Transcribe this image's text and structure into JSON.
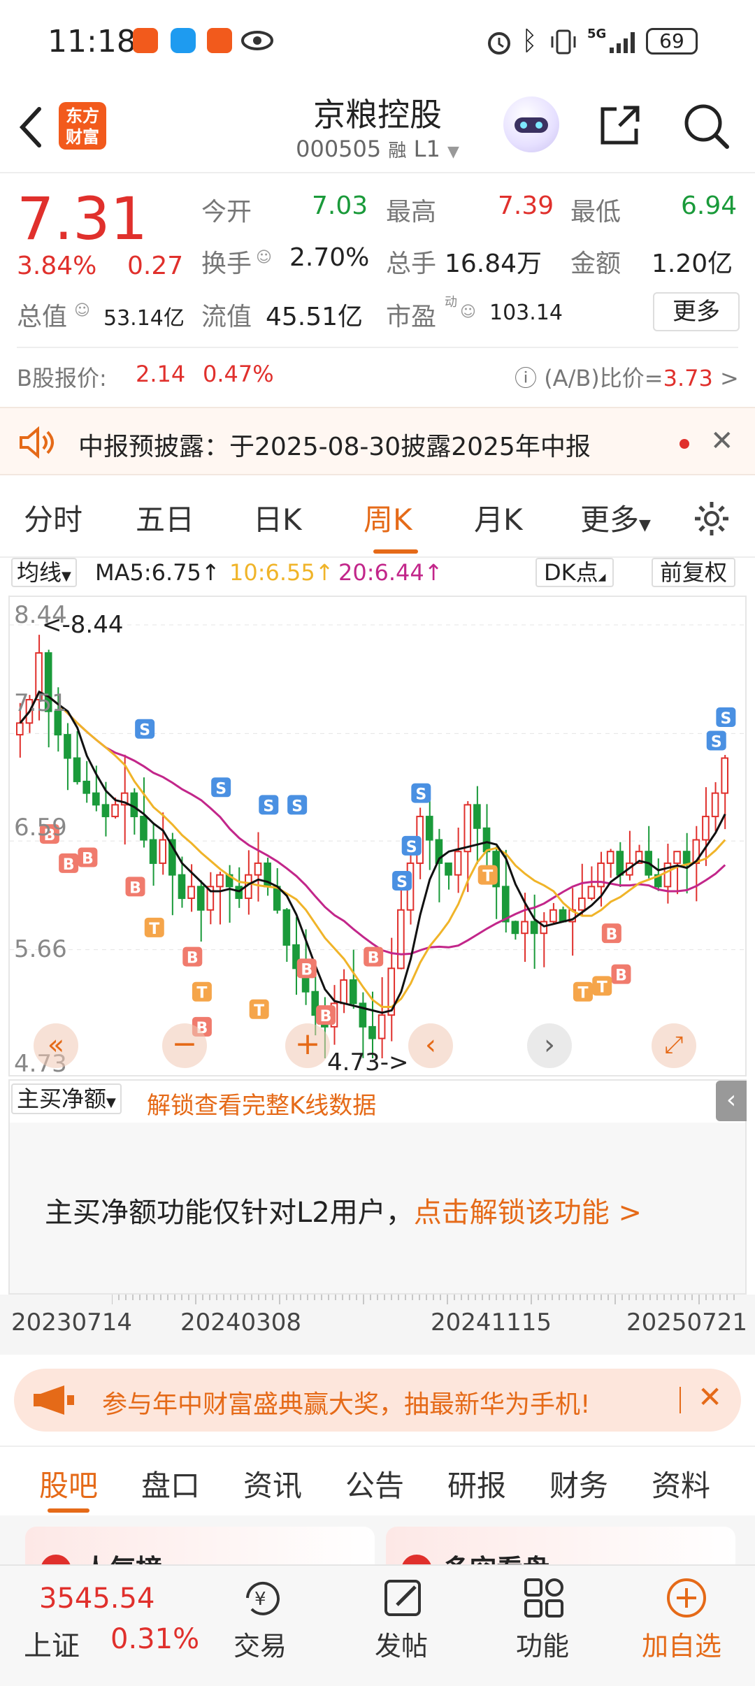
{
  "status": {
    "time": "11:18",
    "battery": "69",
    "network": "5G"
  },
  "header": {
    "logo_line1": "东方",
    "logo_line2": "财富",
    "title": "京粮控股",
    "code": "000505",
    "tag": "融",
    "level": "L1"
  },
  "quote": {
    "price": "7.31",
    "change_pct": "3.84%",
    "change": "0.27",
    "open_label": "今开",
    "open": "7.03",
    "high_label": "最高",
    "high": "7.39",
    "low_label": "最低",
    "low": "6.94",
    "turnover_label": "换手",
    "turnover": "2.70%",
    "volume_label": "总手",
    "volume": "16.84万",
    "amount_label": "金额",
    "amount": "1.20亿",
    "mktcap_label": "总值",
    "mktcap": "53.14亿",
    "float_label": "流值",
    "float": "45.51亿",
    "pe_label": "市盈",
    "pe_sup": "动",
    "pe": "103.14",
    "more_label": "更多"
  },
  "bshare": {
    "label": "B股报价:",
    "price": "2.14",
    "pct": "0.47%",
    "ratio_label": "(A/B)比价=",
    "ratio": "3.73",
    "arrow": ">"
  },
  "notice": {
    "text": "中报预披露：于2025-08-30披露2025年中报"
  },
  "tabs": {
    "items": [
      "分时",
      "五日",
      "日K",
      "周K",
      "月K",
      "更多"
    ],
    "active": "周K"
  },
  "chart_toolbar": {
    "ma_select": "均线",
    "ma5": "MA5:6.75↑",
    "ma10": "10:6.55↑",
    "ma20": "20:6.44↑",
    "dk": "DK点",
    "adjust": "前复权"
  },
  "chart_data": {
    "type": "candlestick",
    "y_ticks": [
      "8.44",
      "7.51",
      "6.59",
      "5.66",
      "4.73"
    ],
    "ylim": [
      4.73,
      8.44
    ],
    "max_label": "<-8.44",
    "min_label": "4.73->",
    "x_ticks": [
      "20230714",
      "20240308",
      "20241115",
      "20250721"
    ],
    "colors": {
      "up": "#e0302c",
      "down": "#1a9a3a",
      "ma5": "#111111",
      "ma10": "#f0b429",
      "ma20": "#c2268a"
    }
  },
  "subchart": {
    "select": "主买净额",
    "unlock": "解锁查看完整K线数据",
    "msg": "主买净额功能仅针对L2用户，",
    "link": "点击解锁该功能 >"
  },
  "banner": {
    "text": "参与年中财富盛典赢大奖，抽最新华为手机!"
  },
  "section_tabs": {
    "items": [
      "股吧",
      "盘口",
      "资讯",
      "公告",
      "研报",
      "财务",
      "资料"
    ],
    "active": "股吧"
  },
  "peek": {
    "left": "人气榜",
    "right": "多空看盘"
  },
  "bottom": {
    "index_value": "3545.54",
    "index_name": "上证",
    "index_pct": "0.31%",
    "trade": "交易",
    "post": "发帖",
    "func": "功能",
    "add": "加自选"
  }
}
